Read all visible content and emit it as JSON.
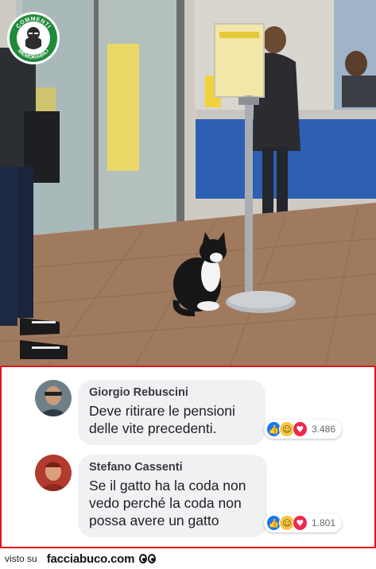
{
  "photo": {
    "logo": {
      "text_top": "COMMENTI",
      "text_bottom": "MEMORABILI",
      "accent": "#1f8a3a"
    },
    "subject_icon": "cat-icon"
  },
  "comments": [
    {
      "author": "Giorgio Rebuscini",
      "text": "Deve ritirare le pensioni\ndelle vite precedenti.",
      "reaction_icons": [
        "like-icon",
        "haha-icon",
        "love-icon"
      ],
      "reaction_count": "3.486"
    },
    {
      "author": "Stefano Cassenti",
      "text": "Se il gatto ha la coda non\nvedo perché la coda non\npossa avere un gatto",
      "reaction_icons": [
        "like-icon",
        "haha-icon",
        "love-icon"
      ],
      "reaction_count": "1.801"
    }
  ],
  "colors": {
    "frame_border": "#e4141b",
    "bubble_bg": "#f0f1f3",
    "like": "#1877f2",
    "haha": "#f7c948",
    "love": "#f0284a"
  },
  "footer": {
    "prefix": "visto su",
    "site": "facciabuco.com"
  }
}
